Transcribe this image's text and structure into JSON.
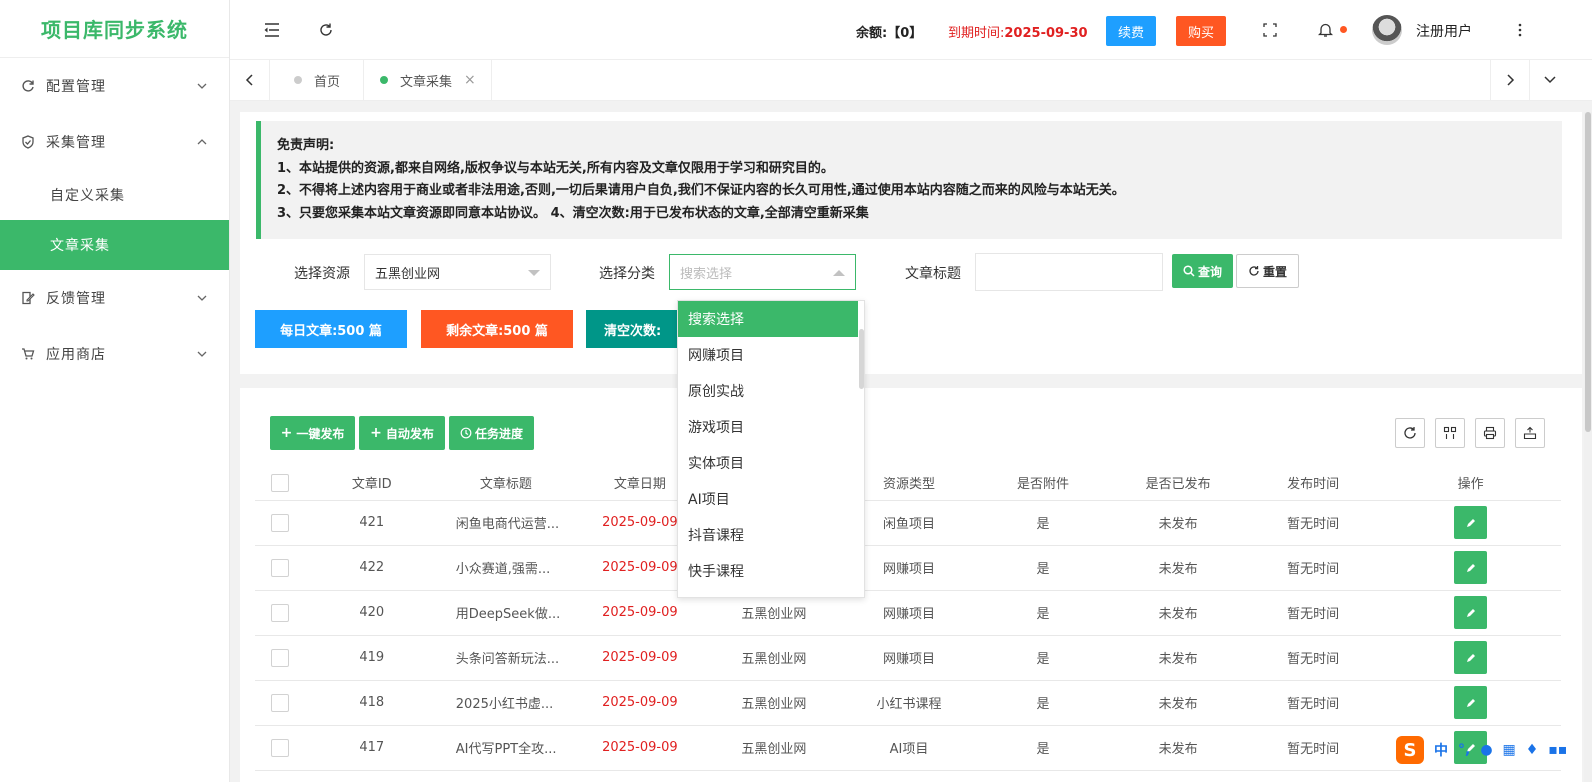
{
  "app": {
    "title": "项目库同步系统"
  },
  "sidebar": {
    "items": [
      {
        "label": "配置管理"
      },
      {
        "label": "采集管理",
        "children": [
          {
            "label": "自定义采集"
          },
          {
            "label": "文章采集"
          }
        ]
      },
      {
        "label": "反馈管理"
      },
      {
        "label": "应用商店"
      }
    ]
  },
  "header": {
    "balance": "余额:【0】",
    "expire_label": "到期时间:",
    "expire_date": "2025-09-30",
    "renew_label": "续费",
    "buy_label": "购买",
    "username": "注册用户"
  },
  "tabs": [
    {
      "label": "首页"
    },
    {
      "label": "文章采集"
    }
  ],
  "notice": {
    "title": "免责声明:",
    "lines": [
      "1、本站提供的资源,都来自网络,版权争议与本站无关,所有内容及文章仅限用于学习和研究目的。",
      "2、不得将上述内容用于商业或者非法用途,否则,一切后果请用户自负,我们不保证内容的长久可用性,通过使用本站内容随之而来的风险与本站无关。",
      "3、只要您采集本站文章资源即同意本站协议。 4、清空次数:用于已发布状态的文章,全部清空重新采集"
    ]
  },
  "filters": {
    "source_label": "选择资源",
    "source_value": "五黑创业网",
    "category_label": "选择分类",
    "category_placeholder": "搜索选择",
    "title_label": "文章标题",
    "title_value": "",
    "query_label": "查询",
    "reset_label": "重置"
  },
  "stats": {
    "daily": "每日文章:500 篇",
    "remaining": "剩余文章:500 篇",
    "clear": "清空次数:"
  },
  "dropdown": {
    "options": [
      "搜索选择",
      "网赚项目",
      "原创实战",
      "游戏项目",
      "实体项目",
      "AI项目",
      "抖音课程",
      "快手课程"
    ],
    "selected": "搜索选择"
  },
  "toolbar": {
    "publish_all": "一键发布",
    "auto_publish": "自动发布",
    "task_progress": "任务进度"
  },
  "table": {
    "columns": [
      "文章ID",
      "文章标题",
      "文章日期",
      "",
      "资源类型",
      "是否附件",
      "是否已发布",
      "发布时间",
      "操作"
    ],
    "rows": [
      {
        "id": "421",
        "title": "闲鱼电商代运营...",
        "date": "2025-09-09",
        "source": "",
        "type": "闲鱼项目",
        "attach": "是",
        "published": "未发布",
        "pub_time": "暂无时间"
      },
      {
        "id": "422",
        "title": "小众赛道,强需...",
        "date": "2025-09-09",
        "source": "",
        "type": "网赚项目",
        "attach": "是",
        "published": "未发布",
        "pub_time": "暂无时间"
      },
      {
        "id": "420",
        "title": "用DeepSeek做...",
        "date": "2025-09-09",
        "source": "五黑创业网",
        "type": "网赚项目",
        "attach": "是",
        "published": "未发布",
        "pub_time": "暂无时间"
      },
      {
        "id": "419",
        "title": "头条问答新玩法...",
        "date": "2025-09-09",
        "source": "五黑创业网",
        "type": "网赚项目",
        "attach": "是",
        "published": "未发布",
        "pub_time": "暂无时间"
      },
      {
        "id": "418",
        "title": "2025小红书虚...",
        "date": "2025-09-09",
        "source": "五黑创业网",
        "type": "小红书课程",
        "attach": "是",
        "published": "未发布",
        "pub_time": "暂无时间"
      },
      {
        "id": "417",
        "title": "AI代写PPT全攻...",
        "date": "2025-09-09",
        "source": "五黑创业网",
        "type": "AI项目",
        "attach": "是",
        "published": "未发布",
        "pub_time": "暂无时间"
      }
    ]
  },
  "ime": {
    "lang": "中"
  },
  "colors": {
    "primary": "#3bb86a",
    "blue": "#1e9fff",
    "orange": "#ff5722",
    "teal": "#009688",
    "red": "#e02020"
  }
}
